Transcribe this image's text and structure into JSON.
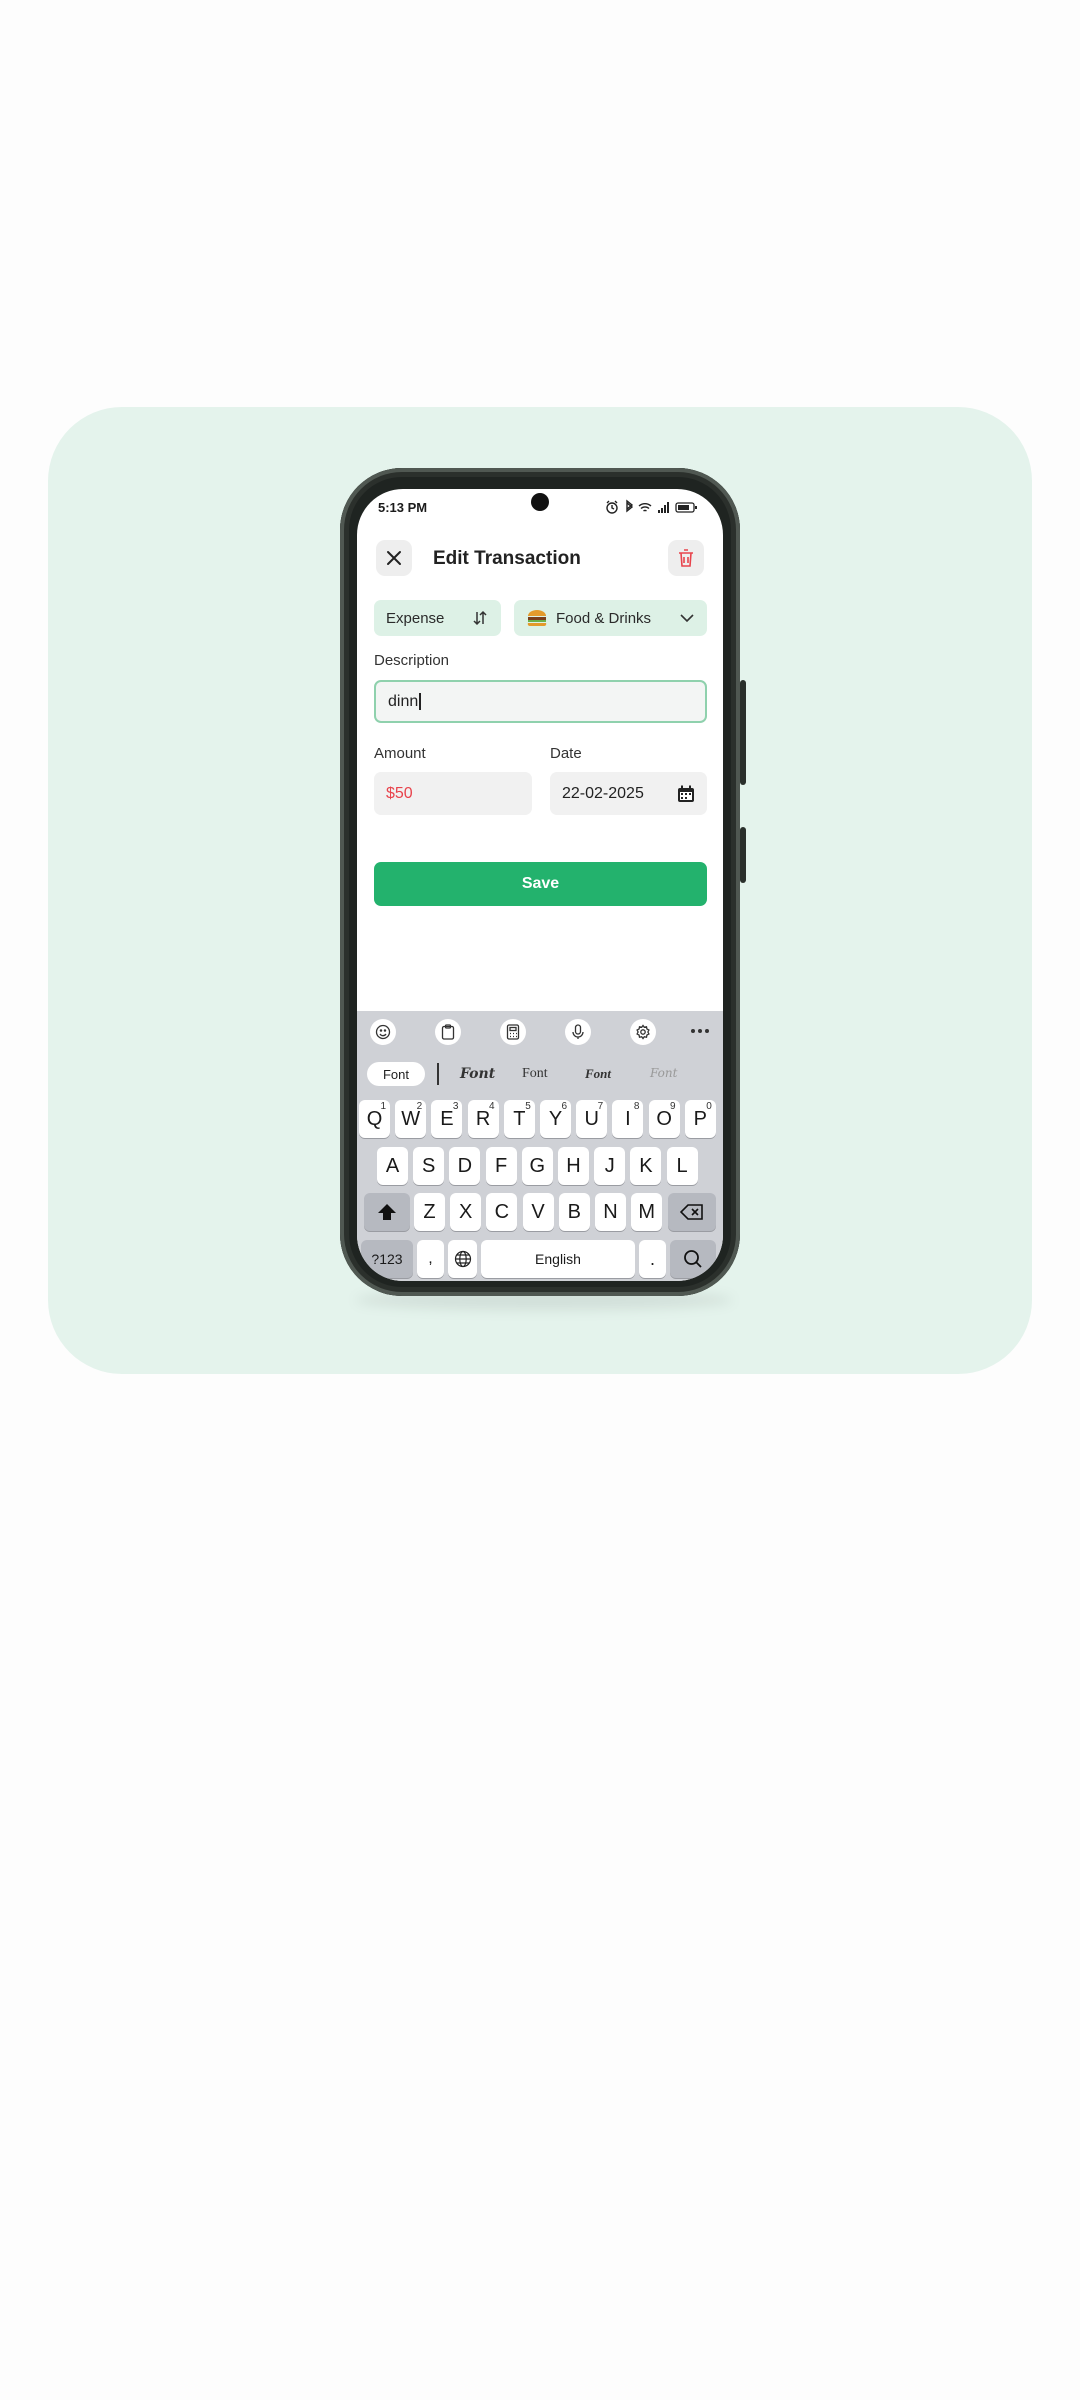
{
  "status_bar": {
    "time": "5:13 PM"
  },
  "header": {
    "title": "Edit Transaction",
    "close_icon": "close-icon",
    "delete_icon": "trash-icon"
  },
  "type_selector": {
    "value": "Expense",
    "icon": "swap-vertical-icon"
  },
  "category_selector": {
    "value": "Food & Drinks",
    "icon": "burger-icon",
    "chevron": "chevron-down-icon"
  },
  "description": {
    "label": "Description",
    "value": "dinn"
  },
  "amount": {
    "label": "Amount",
    "value": "$50"
  },
  "date": {
    "label": "Date",
    "value": "22-02-2025",
    "icon": "calendar-icon"
  },
  "save_button": {
    "label": "Save"
  },
  "keyboard": {
    "toolbar_icons": [
      "emoji-icon",
      "clipboard-icon",
      "calculator-icon",
      "mic-icon",
      "settings-icon",
      "more-icon"
    ],
    "font_options": [
      "Font",
      "Font",
      "Font",
      "Font",
      "Font"
    ],
    "row1": [
      {
        "k": "Q",
        "s": "1"
      },
      {
        "k": "W",
        "s": "2"
      },
      {
        "k": "E",
        "s": "3"
      },
      {
        "k": "R",
        "s": "4"
      },
      {
        "k": "T",
        "s": "5"
      },
      {
        "k": "Y",
        "s": "6"
      },
      {
        "k": "U",
        "s": "7"
      },
      {
        "k": "I",
        "s": "8"
      },
      {
        "k": "O",
        "s": "9"
      },
      {
        "k": "P",
        "s": "0"
      }
    ],
    "row2": [
      "A",
      "S",
      "D",
      "F",
      "G",
      "H",
      "J",
      "K",
      "L"
    ],
    "row3": [
      "Z",
      "X",
      "C",
      "V",
      "B",
      "N",
      "M"
    ],
    "symbols_key": "?123",
    "comma_key": ",",
    "space_key": "English",
    "period_key": "."
  },
  "colors": {
    "accent": "#23b26d",
    "amount": "#e8434c",
    "background_card": "#e4f3ec"
  }
}
